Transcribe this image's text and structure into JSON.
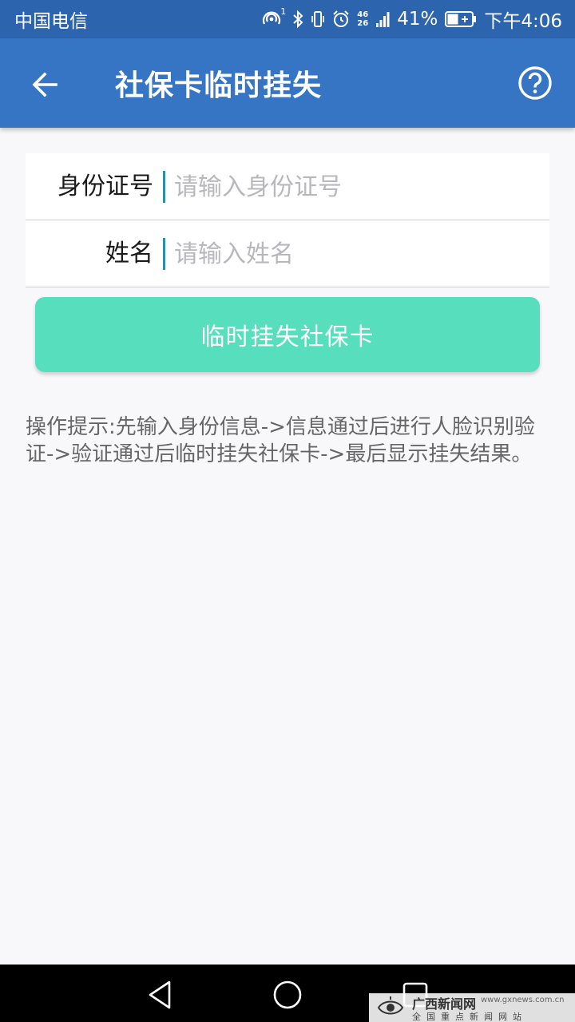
{
  "status_bar": {
    "carrier": "中国电信",
    "hotspot_sup": "1",
    "network_top": "46",
    "network_bottom": "26",
    "battery": "41%",
    "time": "下午4:06"
  },
  "app_bar": {
    "title": "社保卡临时挂失",
    "back_icon": "arrow-left-icon",
    "help_icon": "help-circle-icon"
  },
  "form": {
    "id_label": "身份证号",
    "id_placeholder": "请输入身份证号",
    "id_value": "",
    "name_label": "姓名",
    "name_placeholder": "请输入姓名",
    "name_value": ""
  },
  "submit_label": "临时挂失社保卡",
  "hint": "操作提示:先输入身份信息->信息通过后进行人脸识别验证->验证通过后临时挂失社保卡->最后显示挂失结果。",
  "nav_bar": {
    "back_icon": "triangle-back-icon",
    "home_icon": "circle-home-icon",
    "recents_icon": "square-recents-icon"
  },
  "watermark": {
    "name": "广西新闻网",
    "url": "www.gxnews.com.cn",
    "slogan": "全国重点新闻网站"
  },
  "colors": {
    "status_bar": "#2c64ae",
    "app_bar": "#3575c4",
    "button": "#57dfbd",
    "caret": "#2b8fa7",
    "background": "#f8f8fb"
  }
}
